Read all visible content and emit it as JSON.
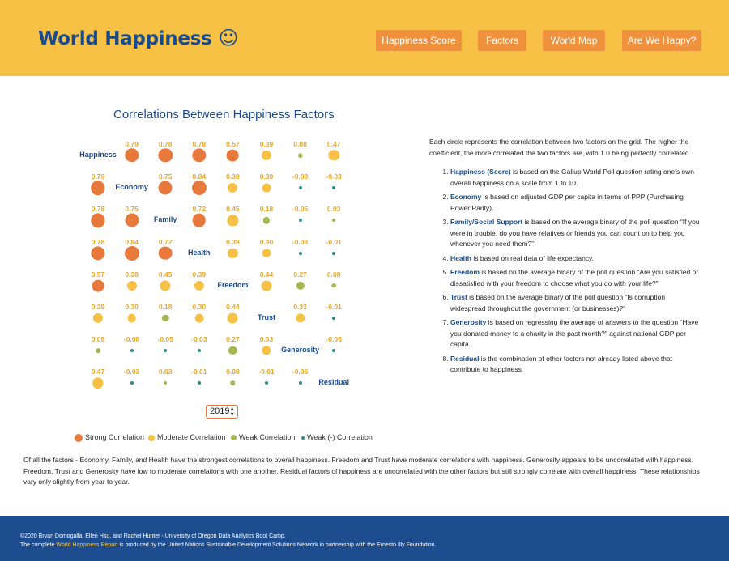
{
  "header": {
    "brand": "World Happiness",
    "smile": "☺",
    "nav": [
      "Happiness Score",
      "Factors",
      "World Map",
      "Are We Happy?"
    ]
  },
  "chart": {
    "title": "Correlations Between Happiness Factors",
    "factors": [
      "Happiness",
      "Economy",
      "Family",
      "Health",
      "Freedom",
      "Trust",
      "Generosity",
      "Residual"
    ],
    "matrix": [
      [
        null,
        0.79,
        0.78,
        0.78,
        0.57,
        0.39,
        0.08,
        0.47
      ],
      [
        0.79,
        null,
        0.75,
        0.84,
        0.38,
        0.3,
        -0.08,
        -0.03
      ],
      [
        0.78,
        0.75,
        null,
        0.72,
        0.45,
        0.18,
        -0.05,
        0.03
      ],
      [
        0.78,
        0.84,
        0.72,
        null,
        0.39,
        0.3,
        -0.03,
        -0.01
      ],
      [
        0.57,
        0.38,
        0.45,
        0.39,
        null,
        0.44,
        0.27,
        0.08
      ],
      [
        0.39,
        0.3,
        0.18,
        0.3,
        0.44,
        null,
        0.33,
        -0.01
      ],
      [
        0.08,
        -0.08,
        -0.05,
        -0.03,
        0.27,
        0.33,
        null,
        -0.05
      ],
      [
        0.47,
        -0.03,
        0.03,
        -0.01,
        0.08,
        -0.01,
        -0.05,
        null
      ]
    ],
    "year": "2019",
    "colors": {
      "strong": "#e8793d",
      "moderate": "#f6c145",
      "weak": "#a3b84f",
      "negative": "#2b8a8a",
      "label": "#e6a82b"
    },
    "legend": [
      "Strong Correlation",
      "Moderate Correlation",
      "Weak Correlation",
      "Weak (-) Correlation"
    ]
  },
  "description": {
    "intro": "Each circle represents the correlation between two factors on the grid. The higher the coefficient, the more correlated the two factors are, with 1.0 being perfectly correlated.",
    "items": [
      {
        "term": "Happiness (Score)",
        "text": " is based on the Gallup World Poll question rating one's own overall happiness on a scale from 1 to 10."
      },
      {
        "term": "Economy",
        "text": " is based on adjusted GDP per capita in terms of PPP (Purchasing Power Parity)."
      },
      {
        "term": "Family/Social Support",
        "text": " is based on the average binary of the poll question “If you were in trouble, do you have relatives or friends you can count on to help you whenever you need them?”"
      },
      {
        "term": "Health",
        "text": " is based on real data of life expectancy."
      },
      {
        "term": "Freedom",
        "text": " is based on the average binary of the poll question “Are you satisfied or dissatisfied with your freedom to choose what you do with your life?”"
      },
      {
        "term": "Trust",
        "text": " is based on the average binary of the poll question “Is corruption widespread throughout the government (or businesses)?”"
      },
      {
        "term": "Generosity",
        "text": " is based on regressing the average of answers to the question “Have you donated money to a charity in the past month?” against national GDP per capita."
      },
      {
        "term": "Residual",
        "text": " is the combination of other factors not already listed above that contribute to happiness."
      }
    ]
  },
  "summary": "Of all the factors - Economy, Family, and Health have the strongest correlations to overall happiness. Freedom and Trust have moderate correlations with happiness. Generosity appears to be uncorrelated with happiness. Freedom, Trust and Generosity have low to moderate correlations with one another. Residual factors of happiness are uncorrelated with the other factors but still strongly correlate with overall happiness. These relationships vary only slightly from year to year.",
  "footer": {
    "credits": "©2020 Bryan Domogalla, Ellen Hsu, and Rachel Hunter - University of Oregon Data Analytics Boot Camp.",
    "pre_link": "The complete ",
    "link": "World Happiness Report",
    "post_link": " is produced by the United Nations Sustainable Development Solutions Network in partnership with the Ernesto Illy Foundation."
  }
}
